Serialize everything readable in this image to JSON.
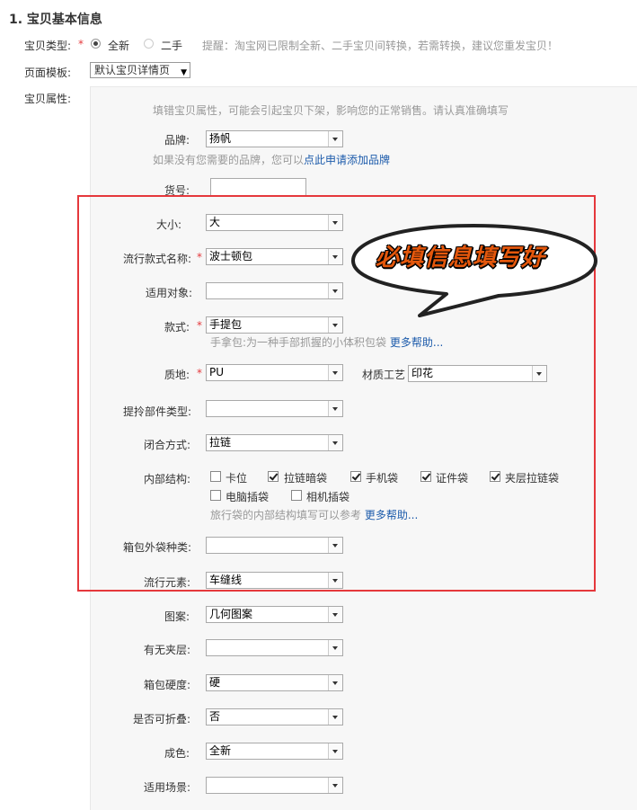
{
  "section_title": "1. 宝贝基本信息",
  "item_type": {
    "label": "宝贝类型:",
    "required_mark": "*",
    "options": [
      {
        "label": "全新",
        "checked": true
      },
      {
        "label": "二手",
        "checked": false
      }
    ],
    "notice": "提醒：淘宝网已限制全新、二手宝贝间转换，若需转换，建议您重发宝贝！"
  },
  "page_template": {
    "label": "页面模板:",
    "value": "默认宝贝详情页"
  },
  "attributes": {
    "label": "宝贝属性:",
    "hint": "填错宝贝属性，可能会引起宝贝下架，影响您的正常销售。请认真准确填写",
    "brand": {
      "label": "品牌:",
      "value": "扬帆",
      "help_prefix": "如果没有您需要的品牌，您可以",
      "help_link": "点此申请添加品牌"
    },
    "item_no": {
      "label": "货号:",
      "value": ""
    },
    "size": {
      "label": "大小:",
      "value": "大"
    },
    "style_name": {
      "label": "流行款式名称:",
      "value": "波士顿包",
      "required_mark": "*"
    },
    "target": {
      "label": "适用对象:",
      "value": ""
    },
    "style": {
      "label": "款式:",
      "value": "手提包",
      "required_mark": "*",
      "help": "手拿包:为一种手部抓握的小体积包袋",
      "help_link": "更多帮助..."
    },
    "material": {
      "label": "质地:",
      "value": "PU",
      "required_mark": "*"
    },
    "craft": {
      "label": "材质工艺",
      "value": "印花"
    },
    "handle_type": {
      "label": "提拎部件类型:",
      "value": ""
    },
    "closure": {
      "label": "闭合方式:",
      "value": "拉链"
    },
    "interior": {
      "label": "内部结构:",
      "options": [
        {
          "label": "卡位",
          "checked": false
        },
        {
          "label": "拉链暗袋",
          "checked": true
        },
        {
          "label": "手机袋",
          "checked": true
        },
        {
          "label": "证件袋",
          "checked": true
        },
        {
          "label": "夹层拉链袋",
          "checked": true
        },
        {
          "label": "电脑插袋",
          "checked": false
        },
        {
          "label": "相机插袋",
          "checked": false
        }
      ],
      "help": "旅行袋的内部结构填写可以参考",
      "help_link": "更多帮助..."
    },
    "outer_pocket": {
      "label": "箱包外袋种类:",
      "value": ""
    },
    "trend": {
      "label": "流行元素:",
      "value": "车缝线"
    },
    "pattern": {
      "label": "图案:",
      "value": "几何图案"
    },
    "interlayer": {
      "label": "有无夹层:",
      "value": ""
    },
    "hardness": {
      "label": "箱包硬度:",
      "value": "硬"
    },
    "foldable": {
      "label": "是否可折叠:",
      "value": "否"
    },
    "condition": {
      "label": "成色:",
      "value": "全新"
    },
    "scene": {
      "label": "适用场景:",
      "value": ""
    }
  },
  "annotation": {
    "callout": "必填信息填写好",
    "highlight_color": "#e5383c",
    "callout_color": "#e4570c"
  }
}
